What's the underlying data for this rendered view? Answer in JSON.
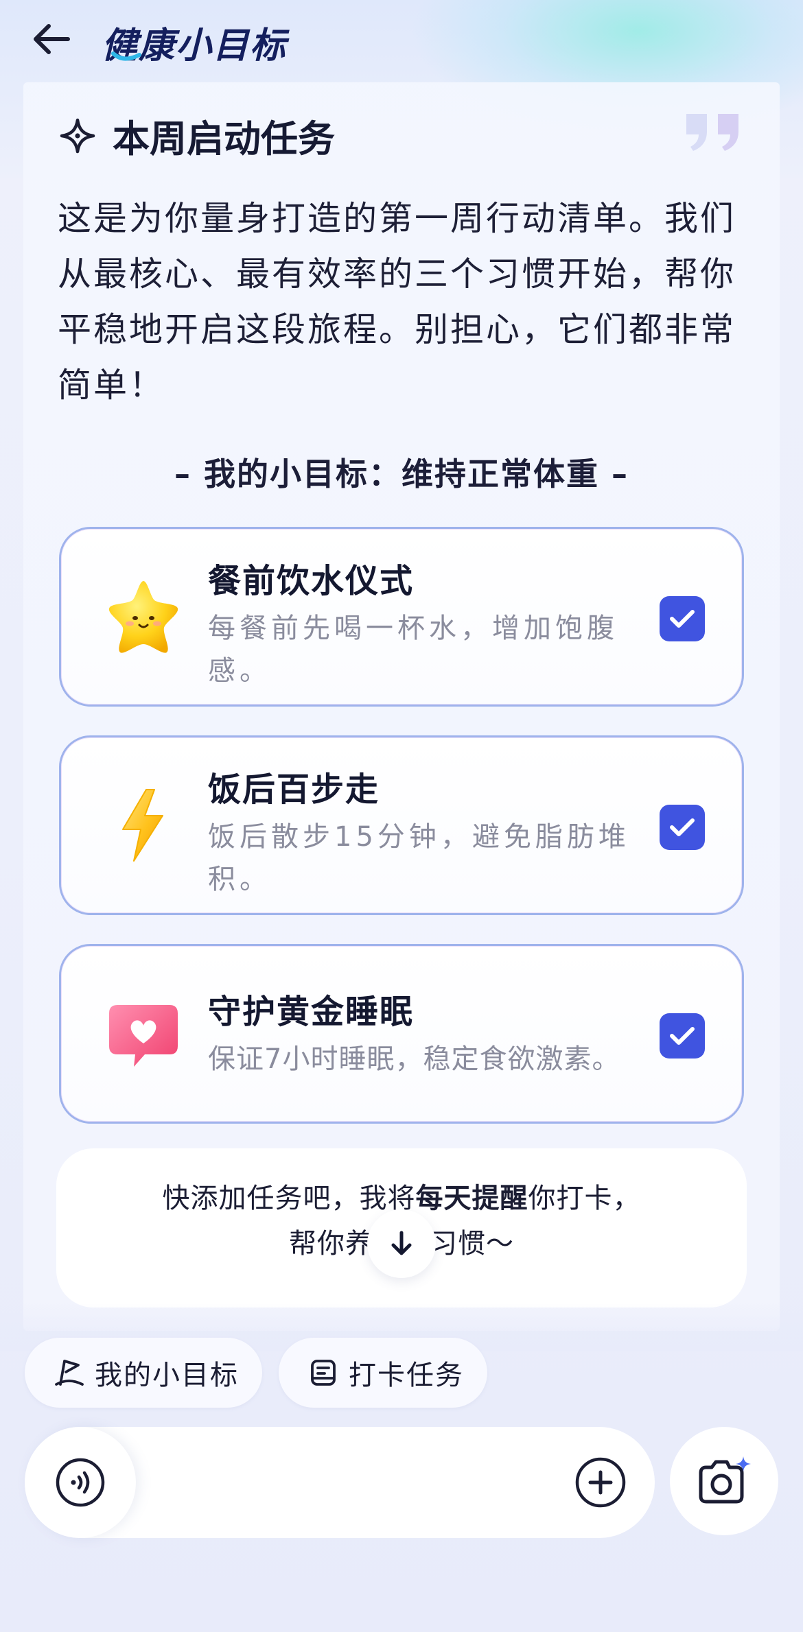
{
  "header": {
    "title": "健康小目标"
  },
  "section": {
    "title": "本周启动任务",
    "intro": "这是为你量身打造的第一周行动清单。我们从最核心、最有效率的三个习惯开始，帮你平稳地开启这段旅程。别担心，它们都非常简单！",
    "goal_line": "– 我的小目标：维持正常体重 –"
  },
  "tasks": [
    {
      "name": "餐前饮水仪式",
      "desc": "每餐前先喝一杯水，增加饱腹感。",
      "checked": true,
      "icon": "star-face-icon"
    },
    {
      "name": "饭后百步走",
      "desc": "饭后散步15分钟，避免脂肪堆积。",
      "checked": true,
      "icon": "lightning-bolt-icon"
    },
    {
      "name": "守护黄金睡眠",
      "desc": "保证7小时睡眠，稳定食欲激素。",
      "checked": true,
      "icon": "heart-bubble-icon"
    }
  ],
  "reminder": {
    "line1_pre": "快添加任务吧，我将",
    "line1_bold": "每天提醒",
    "line1_post": "你打卡，",
    "line2": "帮你养成好习惯～"
  },
  "chips": {
    "goals": "我的小目标",
    "tasks": "打卡任务"
  },
  "colors": {
    "accent": "#4054e0",
    "title": "#141f5e",
    "card_border": "#9fb3ec",
    "muted_text": "#8a8c9d"
  }
}
